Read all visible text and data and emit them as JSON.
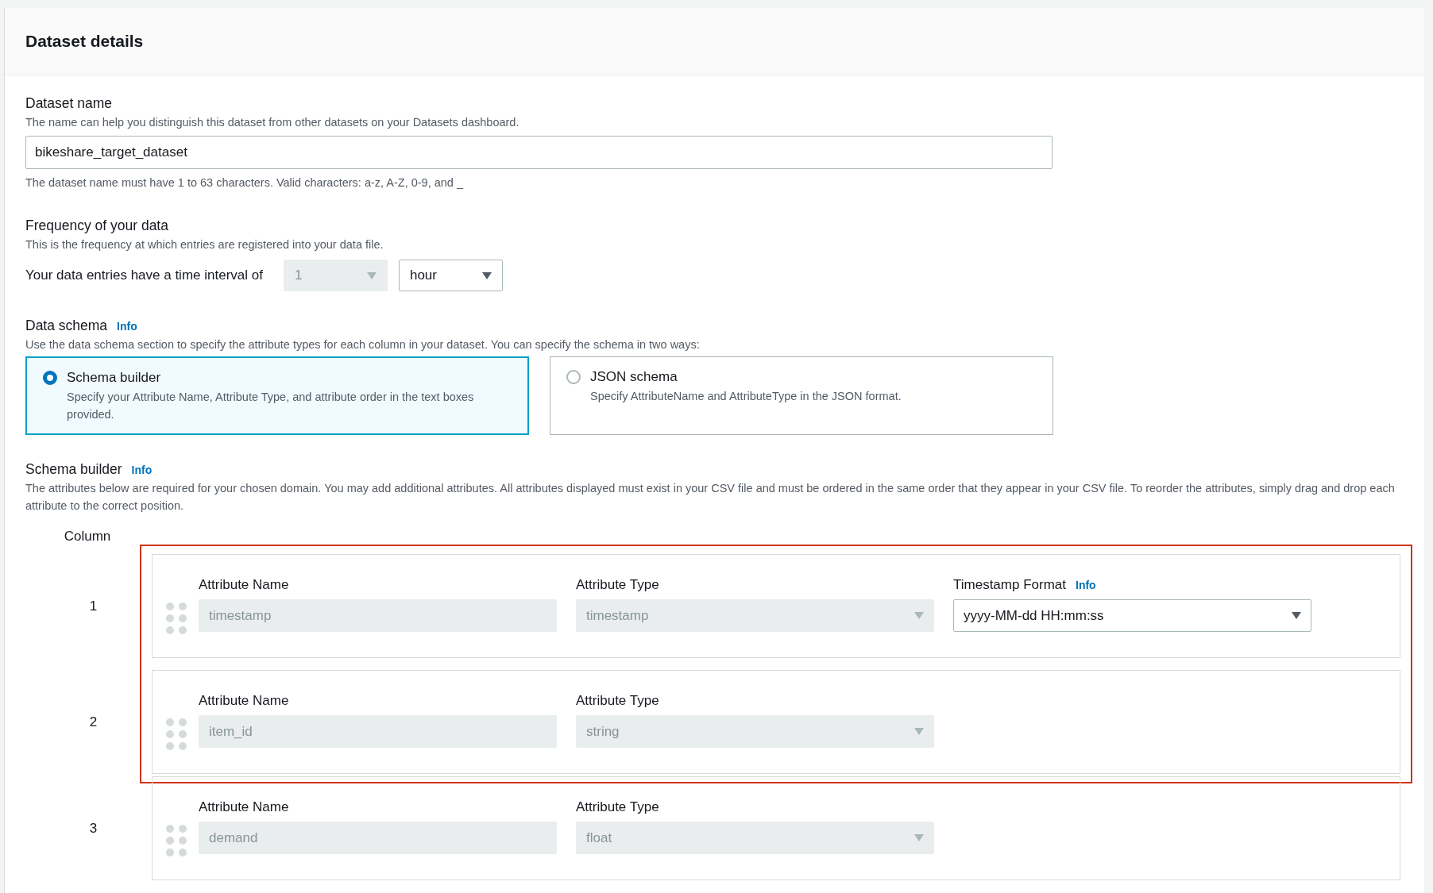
{
  "panel": {
    "title": "Dataset details"
  },
  "dataset_name": {
    "label": "Dataset name",
    "description": "The name can help you distinguish this dataset from other datasets on your Datasets dashboard.",
    "value": "bikeshare_target_dataset",
    "constraint": "The dataset name must have 1 to 63 characters. Valid characters: a-z, A-Z, 0-9, and _"
  },
  "frequency": {
    "label": "Frequency of your data",
    "description": "This is the frequency at which entries are registered into your data file.",
    "interval_label": "Your data entries have a time interval of",
    "interval_value": "1",
    "interval_disabled": true,
    "unit": "hour",
    "unit_disabled": false
  },
  "data_schema": {
    "label": "Data schema",
    "info_link": "Info",
    "description": "Use the data schema section to specify the attribute types for each column in your dataset. You can specify the schema in two ways:",
    "options": [
      {
        "title": "Schema builder",
        "description": "Specify your Attribute Name, Attribute Type, and attribute order in the text boxes provided.",
        "selected": true
      },
      {
        "title": "JSON schema",
        "description": "Specify AttributeName and AttributeType in the JSON format.",
        "selected": false
      }
    ]
  },
  "schema_builder": {
    "label": "Schema builder",
    "info_link": "Info",
    "description": "The attributes below are required for your chosen domain. You may add additional attributes. All attributes displayed must exist in your CSV file and must be ordered in the same order that they appear in your CSV file. To reorder the attributes, simply drag and drop each attribute to the correct position.",
    "column_header": "Column",
    "rows": [
      {
        "number": "1",
        "highlighted": true,
        "fields": [
          {
            "kind": "text",
            "label": "Attribute Name",
            "value": "timestamp",
            "disabled": true
          },
          {
            "kind": "select",
            "label": "Attribute Type",
            "value": "timestamp",
            "disabled": true
          },
          {
            "kind": "select",
            "label": "Timestamp Format",
            "info_link": "Info",
            "value": "yyyy-MM-dd HH:mm:ss",
            "disabled": false
          }
        ]
      },
      {
        "number": "2",
        "highlighted": true,
        "fields": [
          {
            "kind": "text",
            "label": "Attribute Name",
            "value": "item_id",
            "disabled": true
          },
          {
            "kind": "select",
            "label": "Attribute Type",
            "value": "string",
            "disabled": true
          }
        ]
      },
      {
        "number": "3",
        "highlighted": false,
        "fields": [
          {
            "kind": "text",
            "label": "Attribute Name",
            "value": "demand",
            "disabled": true
          },
          {
            "kind": "select",
            "label": "Attribute Type",
            "value": "float",
            "disabled": true
          }
        ]
      }
    ]
  }
}
